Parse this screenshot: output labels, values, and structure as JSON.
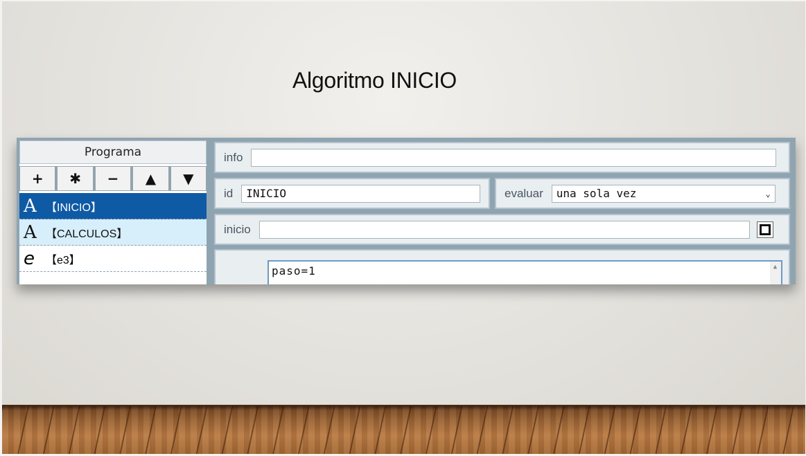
{
  "slide": {
    "title": "Algoritmo INICIO"
  },
  "program": {
    "header": "Programa",
    "toolbar": [
      {
        "name": "add-button",
        "label": "+"
      },
      {
        "name": "duplicate-button",
        "label": "✱"
      },
      {
        "name": "remove-button",
        "label": "−"
      },
      {
        "name": "move-up-button",
        "label": "▲"
      },
      {
        "name": "move-down-button",
        "label": "▼"
      }
    ],
    "items": [
      {
        "glyph": "A",
        "label": "【INICIO】",
        "state": "selected"
      },
      {
        "glyph": "A",
        "label": "【CALCULOS】",
        "state": "highlighted"
      },
      {
        "glyph": "e",
        "label": "【e3】",
        "state": "normal"
      }
    ]
  },
  "editor": {
    "info_label": "info",
    "info_value": "",
    "id_label": "id",
    "id_value": "INICIO",
    "evaluar_label": "evaluar",
    "evaluar_value": "una sola vez",
    "inicio_label": "inicio",
    "inicio_value": "",
    "code": "paso=1"
  },
  "colors": {
    "selected": "#0f5aa5",
    "highlight": "#d7eefb",
    "panel": "#8fa4b1"
  }
}
